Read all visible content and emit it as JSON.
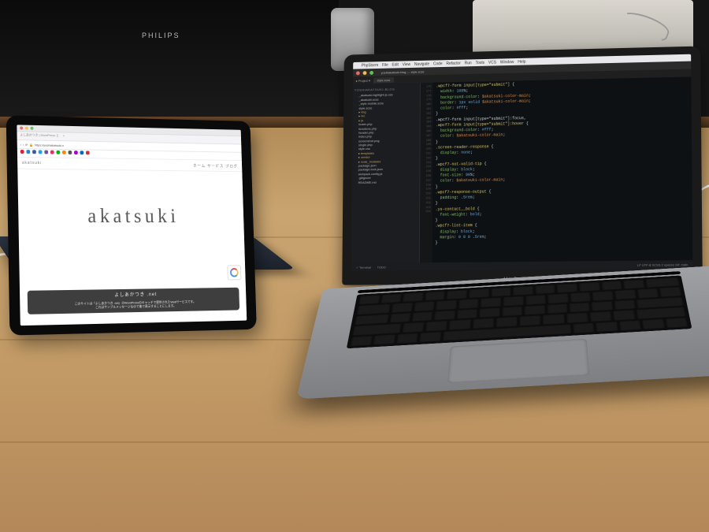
{
  "scene": {
    "monitor_brand": "PHILIPS",
    "laptop_label": "MacBook Pro"
  },
  "ipad": {
    "tab_title": "よしあかつき | WordPress と",
    "url": "https://yoshiakatsuki.n",
    "site_brand": "akatsuki",
    "nav_text": "ホーム  サービス  ブログ",
    "hero": "akatsuki",
    "banner_title": "よしあかつき .net",
    "banner_line1": "このサイトは「よしあかつき .net」のWordPressのキャッチで提供されたWebサービスです。",
    "banner_line2": "これはサンプルメッセージなので後で表示することにします。"
  },
  "mac_menu": {
    "items": [
      "PhpStorm",
      "File",
      "Edit",
      "View",
      "Navigate",
      "Code",
      "Refactor",
      "Run",
      "Tools",
      "VCS",
      "Window",
      "Help"
    ]
  },
  "editor": {
    "titlebar": "yoshiakatsuki-blog — style.scss",
    "tab": "style.scss",
    "project_header": "Project",
    "project_root": "yoshiakatsuki-blog",
    "tree": [
      {
        "t": "_akatsuki-highlight-js.css",
        "f": false
      },
      {
        "t": "_akatsuki.scss",
        "f": false
      },
      {
        "t": "_style-mobile.scss",
        "f": false
      },
      {
        "t": "style.scss",
        "f": false
      },
      {
        "t": "img",
        "f": true
      },
      {
        "t": "inc",
        "f": true
      },
      {
        "t": "js",
        "f": true
      },
      {
        "t": "footer.php",
        "f": false
      },
      {
        "t": "functions.php",
        "f": false
      },
      {
        "t": "header.php",
        "f": false
      },
      {
        "t": "index.php",
        "f": false
      },
      {
        "t": "screenshot.png",
        "f": false
      },
      {
        "t": "single.php",
        "f": false
      },
      {
        "t": "style.css",
        "f": false
      },
      {
        "t": "templates",
        "f": true
      },
      {
        "t": "vendor",
        "f": true
      },
      {
        "t": "node_modules",
        "f": true
      },
      {
        "t": "package.json",
        "f": false
      },
      {
        "t": "package-lock.json",
        "f": false
      },
      {
        "t": "webpack.config.js",
        "f": false
      },
      {
        "t": ".gitignore",
        "f": false
      },
      {
        "t": "README.md",
        "f": false
      }
    ],
    "status_left": "✓ Terminal",
    "status_mid": "TODO",
    "status_right": "LF  UTF-8  SCSS  2 spaces  Git: main"
  },
  "code": {
    "lines": [
      ".wpcf7-form input[type=\"submit\"] {",
      "  width: 100%;",
      "  background-color: $akatsuki-color-main;",
      "  border: 1px solid $akatsuki-color-main;",
      "  color: #fff;",
      "}",
      ".wpcf7-form input[type=\"submit\"]:focus,",
      ".wpcf7-form input[type=\"submit\"]:hover {",
      "  background-color: #fff;",
      "  color: $akatsuki-color-main;",
      "}",
      ".screen-reader-response {",
      "  display: none;",
      "}",
      ".wpcf7-not-valid-tip {",
      "  display: block;",
      "  font-size: 90%;",
      "  color: $akatsuki-color-main;",
      "}",
      ".wpcf7-response-output {",
      "  padding: .5rem;",
      "}",
      ".ys-contact__bold {",
      "  font-weight: bold;",
      "}",
      ".wpcf7-list-item {",
      "  display: block;",
      "  margin: 0 0 0 .5rem;",
      "}"
    ],
    "line_start": 176
  }
}
